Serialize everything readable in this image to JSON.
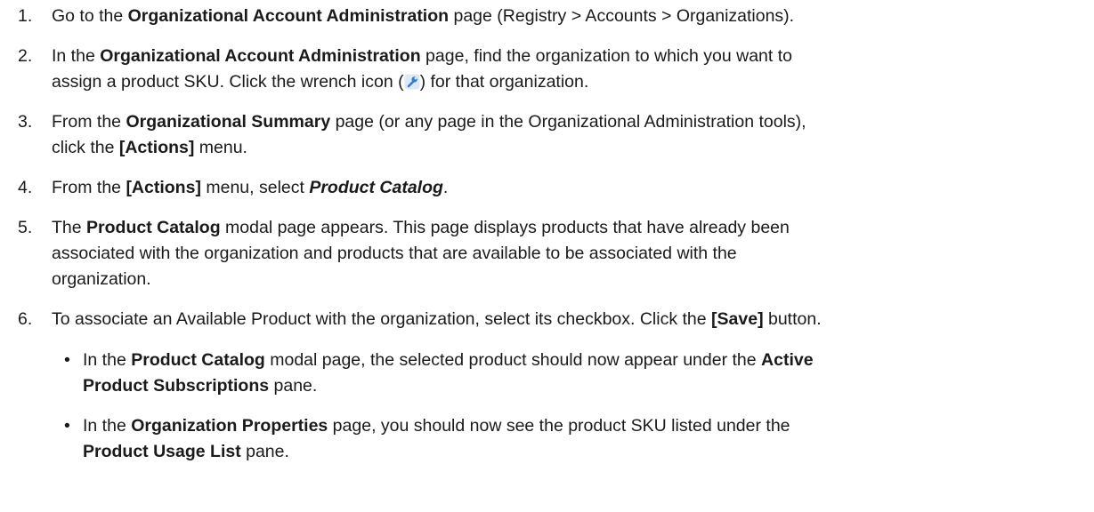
{
  "steps": [
    {
      "number": "1.",
      "parts": [
        "Go to the ",
        "Organizational Account Administration",
        " page (Registry > Accounts > Organizations)."
      ]
    },
    {
      "number": "2.",
      "parts": [
        "In the ",
        "Organizational Account Administration",
        " page, find the organization to which you want to",
        "assign a product SKU. Click the wrench icon (",
        ") for that organization."
      ]
    },
    {
      "number": "3.",
      "parts": [
        "From the ",
        "Organizational Summary",
        " page (or any page in the Organizational Administration tools),",
        "click the ",
        "[Actions]",
        " menu."
      ]
    },
    {
      "number": "4.",
      "parts": [
        "From the ",
        "[Actions]",
        " menu, select ",
        "Product Catalog",
        "."
      ]
    },
    {
      "number": "5.",
      "parts": [
        "The ",
        "Product Catalog",
        " modal page appears. This page displays products that have already been",
        "associated with the organization and products that are available to be associated with the",
        "organization."
      ]
    },
    {
      "number": "6.",
      "parts": [
        "To associate an Available Product with the organization, select its checkbox. Click the ",
        "[Save]",
        " button."
      ]
    }
  ],
  "bullets": [
    {
      "symbol": "•",
      "parts": [
        "In the ",
        "Product Catalog",
        " modal page, the selected product should now appear under the ",
        "Active",
        "Product Subscriptions",
        " pane."
      ]
    },
    {
      "symbol": "•",
      "parts": [
        "In the ",
        "Organization Properties",
        " page, you should now see the product SKU listed under the",
        "Product Usage List",
        " pane."
      ]
    }
  ],
  "icons": {
    "wrench": "wrench-icon",
    "wrench_color": "#3a7bc8"
  }
}
